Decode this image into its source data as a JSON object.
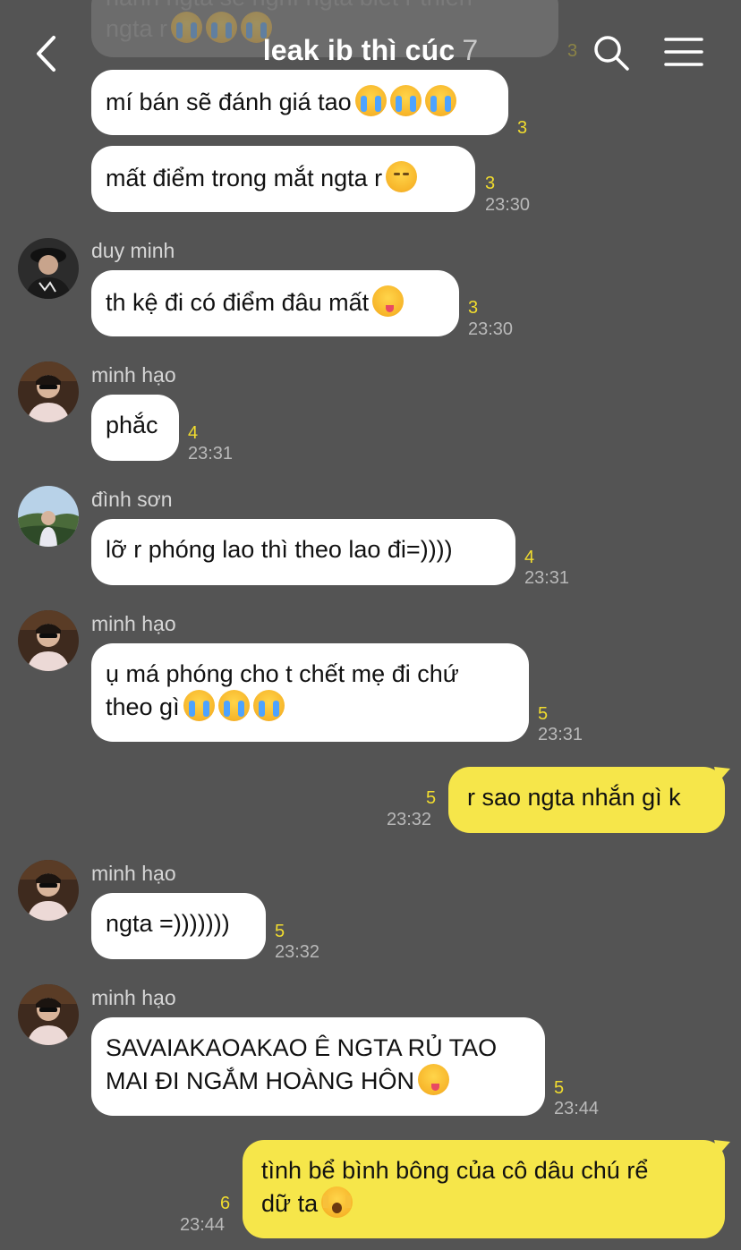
{
  "header": {
    "title": "leak ib thì cúc",
    "member_count": "7"
  },
  "top_partial": {
    "line1": "hành ngta sẽ nghĩ ngta biết r thiên",
    "line2": "ngta r",
    "unread": "3"
  },
  "messages": [
    {
      "id": "m1",
      "text": "mí bán sẽ đánh giá tao",
      "unread": "3",
      "time": ""
    },
    {
      "id": "m2",
      "text": "mất điểm trong mắt ngta r",
      "unread": "3",
      "time": "23:30"
    },
    {
      "id": "m3",
      "sender": "duy minh",
      "text": "th kệ đi có điểm đâu mất",
      "unread": "3",
      "time": "23:30"
    },
    {
      "id": "m4",
      "sender": "minh hạo",
      "text": "phắc",
      "unread": "4",
      "time": "23:31"
    },
    {
      "id": "m5",
      "sender": "đình sơn",
      "text": "lỡ r phóng lao thì theo lao đi=))))",
      "unread": "4",
      "time": "23:31"
    },
    {
      "id": "m6",
      "sender": "minh hạo",
      "line1": "ụ má phóng cho t chết mẹ đi chứ",
      "line2": "theo gì",
      "unread": "5",
      "time": "23:31"
    },
    {
      "id": "m7",
      "text": "r sao ngta nhắn gì k",
      "unread": "5",
      "time": "23:32"
    },
    {
      "id": "m8",
      "sender": "minh hạo",
      "text": "ngta =)))))))",
      "unread": "5",
      "time": "23:32"
    },
    {
      "id": "m9",
      "sender": "minh hạo",
      "line1": "SAVAIAKAOAKAO Ê NGTA RỦ TAO",
      "line2": "MAI ĐI NGẮM HOÀNG HÔN",
      "unread": "5",
      "time": "23:44"
    },
    {
      "id": "m10",
      "line1": "tình bể bình bông của cô dâu chú rể",
      "line2": "dữ ta",
      "unread": "6",
      "time": "23:44"
    }
  ],
  "colors": {
    "background": "#545454",
    "incoming_bubble": "#ffffff",
    "outgoing_bubble": "#f6e64a",
    "unread": "#f1dc2e",
    "time": "#b9b9b9"
  },
  "icons": [
    "back-arrow-icon",
    "search-icon",
    "menu-icon",
    "crying-face-icon",
    "disappointed-face-icon",
    "yum-face-icon",
    "shocked-face-icon"
  ]
}
